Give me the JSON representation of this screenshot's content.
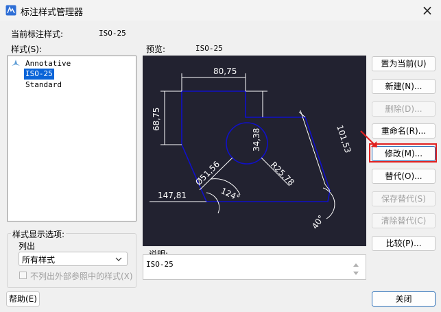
{
  "window": {
    "title": "标注样式管理器",
    "close_symbol": "×"
  },
  "current_style": {
    "label": "当前标注样式:",
    "value": "ISO-25"
  },
  "styles": {
    "label": "样式(S):",
    "items": [
      {
        "name": "Annotative",
        "selected": false
      },
      {
        "name": "ISO-25",
        "selected": true
      },
      {
        "name": "Standard",
        "selected": false
      }
    ]
  },
  "preview": {
    "label": "预览:",
    "style_name": "ISO-25",
    "dims": [
      "80,75",
      "68,75",
      "34,38",
      "101,53",
      "Ø51,56",
      "R25,78",
      "124°",
      "147,81",
      "40°"
    ]
  },
  "buttons": {
    "set_current": "置为当前(U)",
    "new": "新建(N)...",
    "delete": "删除(D)...",
    "rename": "重命名(R)...",
    "modify": "修改(M)...",
    "override": "替代(O)...",
    "save_override": "保存替代(S)",
    "clear_override": "清除替代(C)",
    "compare": "比较(P)...",
    "help": "帮助(E)",
    "close": "关闭"
  },
  "display_options": {
    "legend": "样式显示选项:",
    "list_label": "列出",
    "list_value": "所有样式",
    "exclude_xref_label": "不列出外部参照中的样式(X)"
  },
  "description": {
    "label": "说明:",
    "text": "ISO-25"
  },
  "colors": {
    "preview_bg": "#222230",
    "geometry": "#1010c8",
    "dim_lines": "#ffffff",
    "selection": "#0a64d8",
    "highlight": "#e02020"
  }
}
